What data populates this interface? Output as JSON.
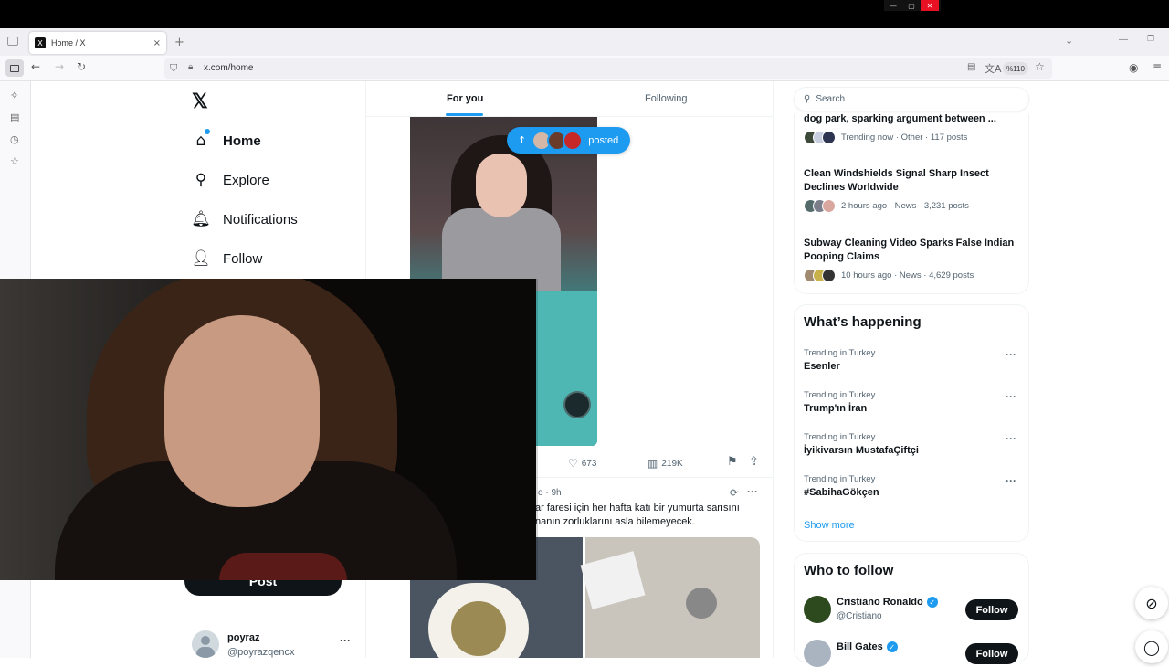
{
  "browser": {
    "tab_title": "Home / X",
    "tab_favicon": "X",
    "tab_close": "×",
    "new_tab": "+",
    "url": "x.com/home",
    "zoom": "%110",
    "icons": {
      "back": "←",
      "forward": "→",
      "reload": "↻",
      "shield": "⛉",
      "lock": "🔒︎",
      "reader": "▤",
      "translate": "文A",
      "star": "☆",
      "account": "◉",
      "menu": "≡",
      "tabs_menu": "⌄",
      "minimize": "—",
      "maximize": "❐"
    },
    "sidebar_icons": [
      "✧",
      "▤",
      "◷",
      "☆"
    ],
    "os_controls": [
      "—",
      "▢",
      "✕"
    ]
  },
  "nav": {
    "logo": "𝕏",
    "items": [
      {
        "label": "Home",
        "icon": "⌂"
      },
      {
        "label": "Explore",
        "icon": "⚲"
      },
      {
        "label": "Notifications",
        "icon": "🔔︎"
      },
      {
        "label": "Follow",
        "icon": "👤︎"
      }
    ],
    "post_label": "Post"
  },
  "profile": {
    "name": "poyraz",
    "handle": "@poyrazqencx",
    "more": "···"
  },
  "feed": {
    "tabs": [
      "For you",
      "Following"
    ],
    "pill_arrow": "↑",
    "pill_text": "posted",
    "post1": {
      "likes": "673",
      "views": "219K",
      "like_icon": "♡",
      "views_icon": "▥",
      "bookmark_icon": "⚑",
      "share_icon": "⇪"
    },
    "post2": {
      "time": "o · 9h",
      "grok_icon": "⟳",
      "more": "···",
      "line1": "ar faresi için her hafta katı bir yumurta sarısını",
      "line2": "nanın zorluklarını asla bilemeyecek."
    }
  },
  "search": {
    "placeholder": "Search",
    "icon": "⚲"
  },
  "news": [
    {
      "title": "dog park, sparking argument between ...",
      "meta": "Trending now · Other · 117 posts",
      "avatar_colors": [
        "#3d4a3a",
        "#c8d0e0",
        "#2e3550"
      ]
    },
    {
      "title": "Clean Windshields Signal Sharp Insect Declines Worldwide",
      "meta": "2 hours ago · News · 3,231 posts",
      "avatar_colors": [
        "#556b6b",
        "#7a7e8a",
        "#d9a7a0"
      ]
    },
    {
      "title": "Subway Cleaning Video Sparks False Indian Pooping Claims",
      "meta": "10 hours ago · News · 4,629 posts",
      "avatar_colors": [
        "#a08a70",
        "#c8b04a",
        "#333333"
      ]
    }
  ],
  "happening": {
    "title": "What’s happening",
    "trends": [
      {
        "context": "Trending in Turkey",
        "name": "Esenler"
      },
      {
        "context": "Trending in Turkey",
        "name": "Trump'ın İran"
      },
      {
        "context": "Trending in Turkey",
        "name": "İyikivarsın MustafaÇiftçi"
      },
      {
        "context": "Trending in Turkey",
        "name": "#SabihaGökçen"
      }
    ],
    "more_icon": "···",
    "show_more": "Show more"
  },
  "who_to_follow": {
    "title": "Who to follow",
    "users": [
      {
        "name": "Cristiano Ronaldo",
        "handle": "@Cristiano",
        "follow": "Follow",
        "avatar_color": "#2c4a1e"
      },
      {
        "name": "Bill Gates",
        "handle": "",
        "follow": "Follow",
        "avatar_color": "#a9b4c0"
      }
    ],
    "verified_mark": "✓"
  },
  "fab": {
    "grok_icon": "⊘",
    "messages_icon": "◯"
  },
  "colors": {
    "accent": "#1d9bf0",
    "text": "#0f1419",
    "muted": "#536471",
    "border": "#eff3f4"
  }
}
